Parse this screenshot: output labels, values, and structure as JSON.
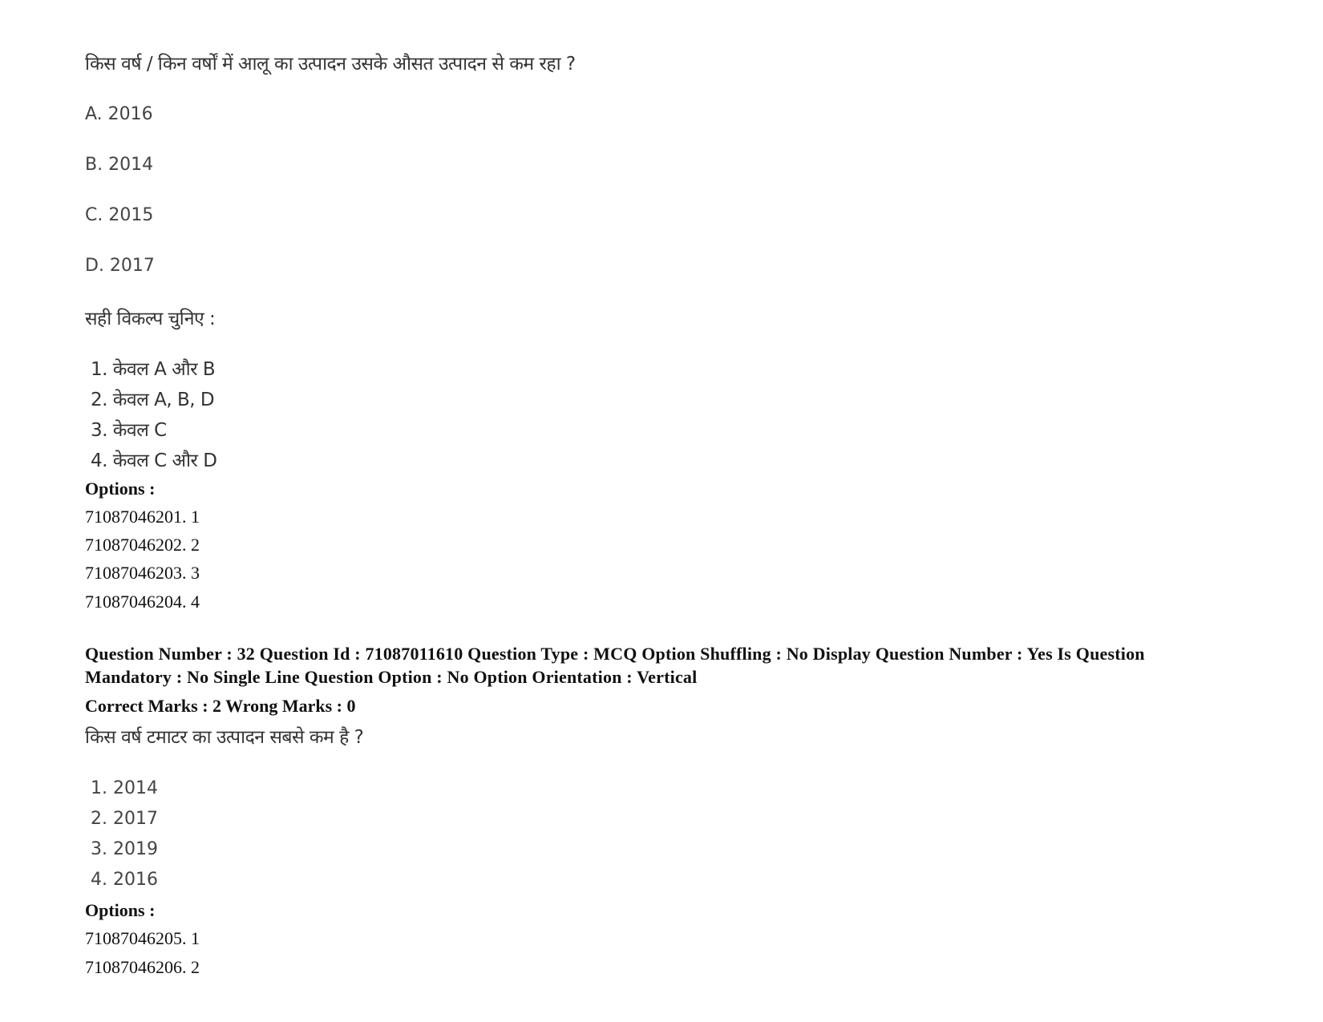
{
  "q31": {
    "question": "किस वर्ष / किन वर्षों में आलू का उत्पादन उसके औसत उत्पादन से कम रहा ?",
    "statements": [
      "A. 2016",
      "B. 2014",
      "C. 2015",
      "D. 2017"
    ],
    "instruction": "सही विकल्प चुनिए :",
    "choices": [
      "1. केवल A और B",
      "2. केवल A, B, D",
      "3. केवल C",
      "4. केवल C और D"
    ],
    "options_label": "Options :",
    "options": [
      "71087046201. 1",
      "71087046202. 2",
      "71087046203. 3",
      "71087046204. 4"
    ]
  },
  "q32": {
    "meta_line": "Question Number : 32 Question Id : 71087011610 Question Type : MCQ Option Shuffling : No Display Question Number : Yes Is Question Mandatory : No Single Line Question Option : No Option Orientation : Vertical",
    "marks": "Correct Marks : 2 Wrong Marks : 0",
    "question": "किस वर्ष टमाटर का उत्पादन सबसे कम है ?",
    "choices": [
      "1. 2014",
      "2. 2017",
      "3. 2019",
      "4. 2016"
    ],
    "options_label": "Options :",
    "options": [
      "71087046205. 1",
      "71087046206. 2"
    ]
  }
}
